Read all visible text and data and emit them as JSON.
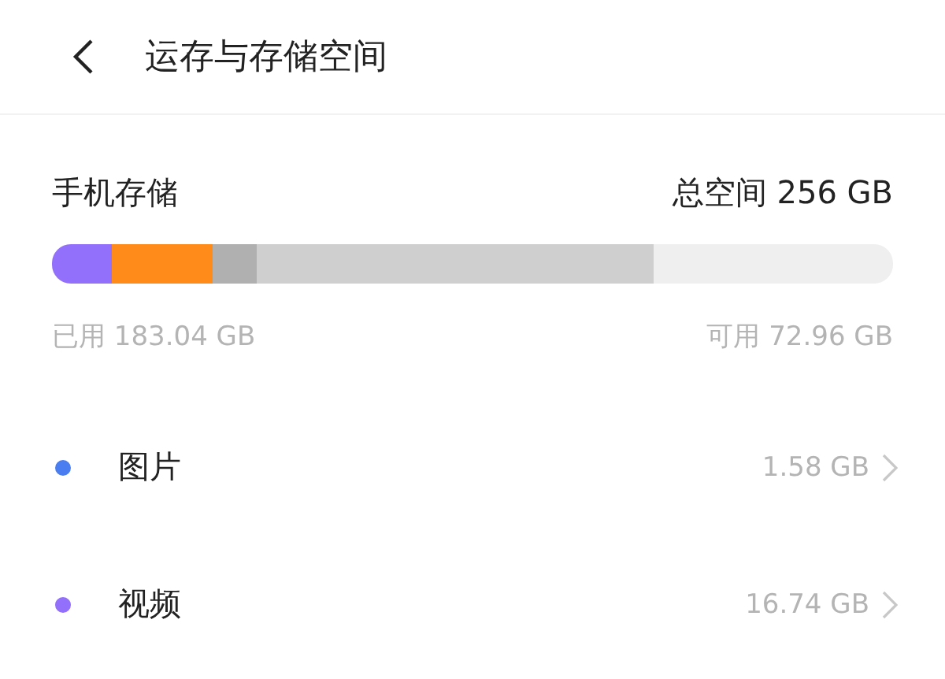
{
  "header": {
    "title": "运存与存储空间"
  },
  "storage": {
    "title": "手机存储",
    "total": "总空间 256 GB",
    "segments": [
      {
        "color": "#9370fb",
        "level": 0.071
      },
      {
        "color": "#ff8c1a",
        "level": 0.12
      },
      {
        "color": "#b0b0b0"
      },
      {
        "color": "#cfcfcf",
        "level": 0.472
      }
    ],
    "used": "已用 183.04 GB",
    "free": "可用 72.96 GB"
  },
  "categories": [
    {
      "name": "图片",
      "size": "1.58 GB",
      "color": "#4a7ef0"
    },
    {
      "name": "视频",
      "size": "16.74 GB",
      "color": "#9370fb"
    }
  ]
}
